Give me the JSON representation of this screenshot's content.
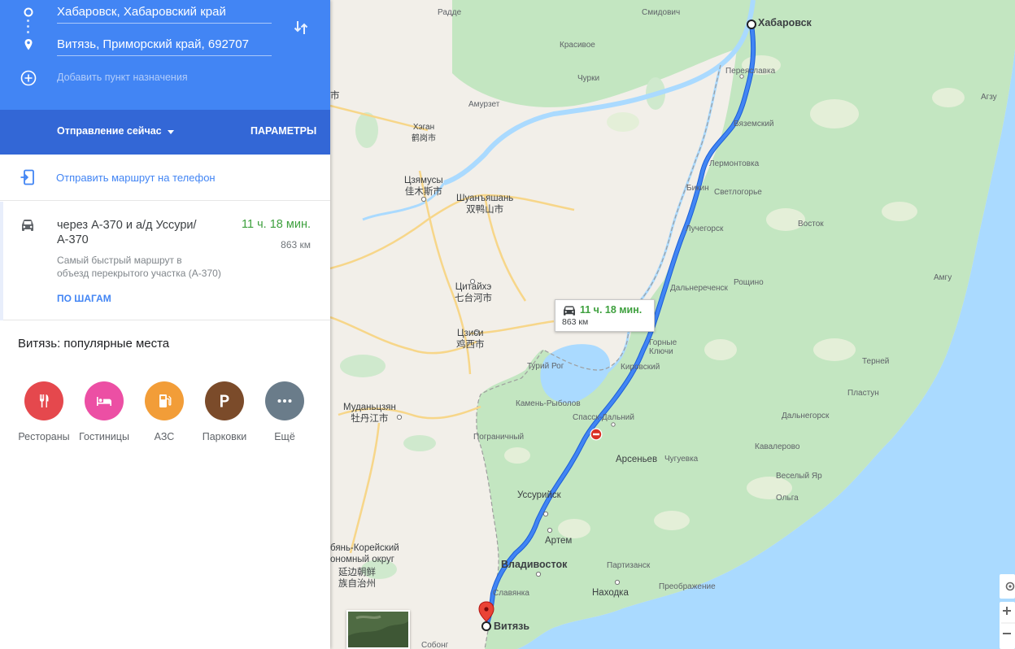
{
  "directions": {
    "origin": "Хабаровск, Хабаровский край",
    "destination": "Витязь, Приморский край, 692707",
    "add_destination": "Добавить пункт назначения",
    "departure": "Отправление сейчас",
    "options": "ПАРАМЕТРЫ",
    "send_to_phone": "Отправить маршрут на телефон"
  },
  "route": {
    "via_line1": "через А-370 и а/д Уссури/",
    "via_line2": "А-370",
    "duration": "11 ч. 18 мин.",
    "distance": "863 км",
    "note_line1": "Самый быстрый маршрут в",
    "note_line2": "объезд перекрытого участка (А-370)",
    "steps": "ПО ШАГАМ"
  },
  "popular": {
    "title": "Витязь: популярные места",
    "categories": [
      {
        "label": "Рестораны",
        "icon": "restaurant-icon",
        "color": "#e5484d"
      },
      {
        "label": "Гостиницы",
        "icon": "hotel-icon",
        "color": "#ec4fa4"
      },
      {
        "label": "АЗС",
        "icon": "gas-station-icon",
        "color": "#f29d38"
      },
      {
        "label": "Парковки",
        "icon": "parking-icon",
        "color": "#7b4b2a"
      },
      {
        "label": "Ещё",
        "icon": "more-icon",
        "color": "#6a7c8a"
      }
    ]
  },
  "map": {
    "bubble_time": "11 ч. 18 мин.",
    "bubble_distance": "863 км",
    "colors": {
      "land": "#f2efe9",
      "forest": "#c3e6c1",
      "water": "#aadaff",
      "route": "#4285f4",
      "route_time": "#3ea03e"
    },
    "labels": {
      "khabarovsk": "Хабаровск",
      "vityaz": "Витязь",
      "vladivostok": "Владивосток",
      "ussuriysk": "Уссурийск",
      "artem": "Артем",
      "nakhodka": "Находка",
      "arsenyev": "Арсеньев",
      "spassk": "Спасск-Дальний",
      "lesozavodsk": "Кировский",
      "dalnerechensk": "Дальнереченск",
      "luchegorsk": "Лучегорск",
      "bikin": "Бикин",
      "vyazemsky": "Вяземский",
      "pereyaslavka": "Переяславка",
      "lermontovka": "Лермонтовка",
      "svetlogorye": "Светлогорье",
      "vostok": "Восток",
      "roshchino": "Рощино",
      "gornye_klyuchi_1": "Горные",
      "gornye_klyuchi_2": "Ключи",
      "kamen_rybolov": "Камень-Рыболов",
      "pogranichny": "Пограничный",
      "turiy_rog": "Турий Рог",
      "chuguevka": "Чугуевка",
      "kavalerovo": "Кавалерово",
      "dalnegorsk": "Дальнегорск",
      "plastun": "Пластун",
      "terney": "Терней",
      "amgu": "Амгу",
      "agzu": "Агзу",
      "vesely_yar": "Веселый Яр",
      "olga": "Ольга",
      "preobrazhenie": "Преображение",
      "partizansk": "Партизанск",
      "slavyanka": "Славянка",
      "sobong": "Собонг",
      "radde": "Радде",
      "smidovich": "Смидович",
      "krasnoe": "Красивое",
      "chirki": "Чурки",
      "amurzet": "Амурзет",
      "hegang": "Хэган",
      "hegang_cn": "鹤岗市",
      "jiamusi": "Цзямусы",
      "jiamusi_cn": "佳木斯市",
      "shuangyashan": "Шуанъяшань",
      "shuangyashan_cn": "双鸭山市",
      "qitaihe": "Цитайхэ",
      "qitaihe_cn": "七台河市",
      "jixi": "Цзиси",
      "jixi_cn": "鸡西市",
      "mudanjiang": "Муданьцзян",
      "mudanjiang_cn": "牡丹江市",
      "yanbian_1": "бянь-Корейский",
      "yanbian_2": "ономный округ",
      "yanbian_cn1": "延边朝鲜",
      "yanbian_cn2": "族自治州",
      "shi": "市"
    }
  }
}
